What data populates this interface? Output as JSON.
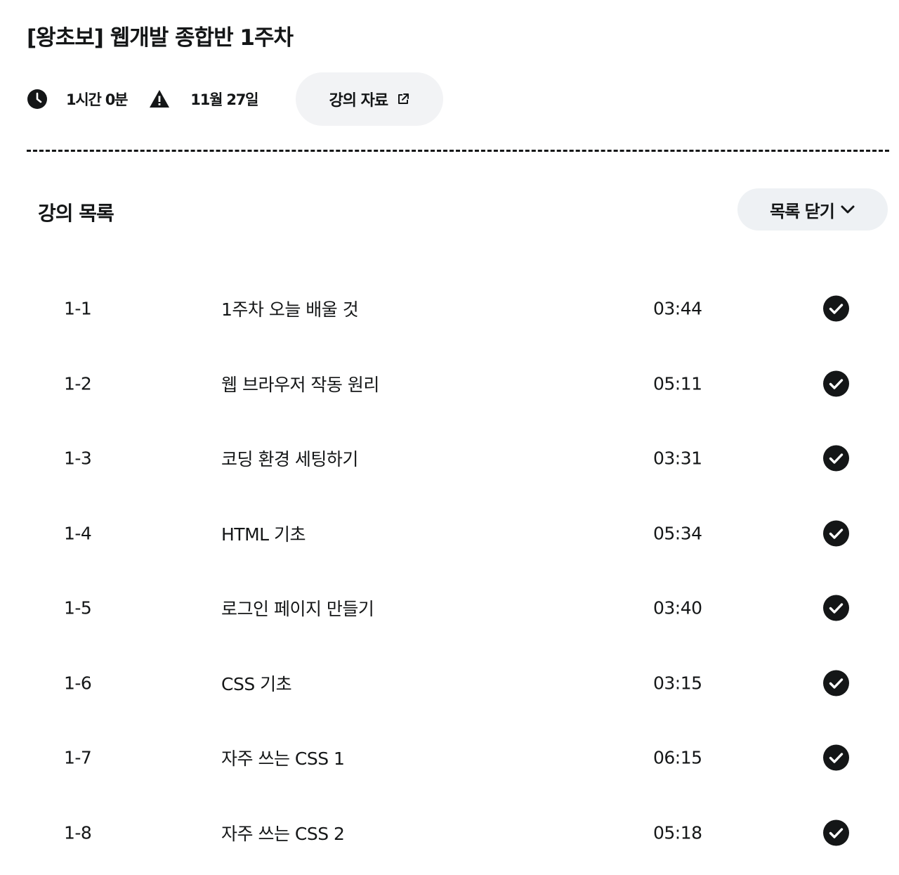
{
  "header": {
    "title": "[왕초보] 웹개발 종합반 1주차",
    "duration": "1시간 0분",
    "deadline": "11월 27일",
    "materials_label": "강의 자료"
  },
  "lecture_section": {
    "title": "강의 목록",
    "toggle_label": "목록 닫기",
    "lectures": [
      {
        "number": "1-1",
        "title": "1주차 오늘 배울 것",
        "time": "03:44",
        "completed": true
      },
      {
        "number": "1-2",
        "title": "웹 브라우저 작동 원리",
        "time": "05:11",
        "completed": true
      },
      {
        "number": "1-3",
        "title": "코딩 환경 세팅하기",
        "time": "03:31",
        "completed": true
      },
      {
        "number": "1-4",
        "title": "HTML 기초",
        "time": "05:34",
        "completed": true
      },
      {
        "number": "1-5",
        "title": "로그인 페이지 만들기",
        "time": "03:40",
        "completed": true
      },
      {
        "number": "1-6",
        "title": "CSS 기초",
        "time": "03:15",
        "completed": true
      },
      {
        "number": "1-7",
        "title": "자주 쓰는 CSS 1",
        "time": "06:15",
        "completed": true
      },
      {
        "number": "1-8",
        "title": "자주 쓰는 CSS 2",
        "time": "05:18",
        "completed": true
      }
    ]
  },
  "icons": {
    "duration": "clock-icon",
    "deadline": "warning-icon",
    "materials": "external-link-icon",
    "toggle": "chevron-down-icon",
    "completed": "check-circle-icon"
  },
  "colors": {
    "text": "#141617",
    "button_bg": "#f2f3f5",
    "toggle_bg": "#eef1f4"
  }
}
